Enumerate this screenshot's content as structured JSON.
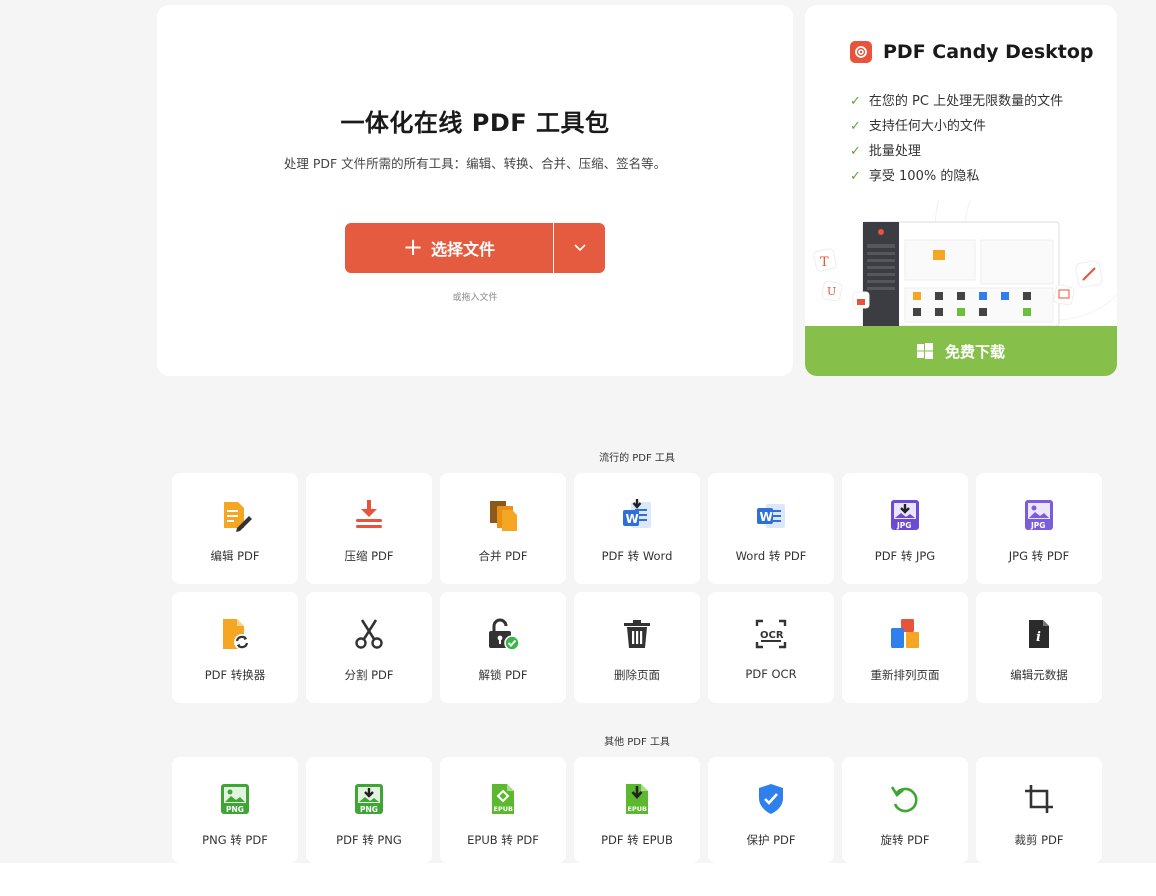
{
  "hero": {
    "title": "一体化在线 PDF 工具包",
    "subtitle": "处理 PDF 文件所需的所有工具：编辑、转换、合并、压缩、签名等。",
    "upload_label": "选择文件",
    "drop_hint": "或拖入文件"
  },
  "promo": {
    "title": "PDF Candy Desktop",
    "features": [
      "在您的 PC 上处理无限数量的文件",
      "支持任何大小的文件",
      "批量处理",
      "享受 100% 的隐私"
    ],
    "download_label": "免费下载"
  },
  "popular": {
    "label": "流行的 PDF 工具",
    "tools": [
      {
        "label": "编辑 PDF",
        "icon": "edit-pdf-icon"
      },
      {
        "label": "压缩 PDF",
        "icon": "compress-pdf-icon"
      },
      {
        "label": "合并 PDF",
        "icon": "merge-pdf-icon"
      },
      {
        "label": "PDF 转 Word",
        "icon": "pdf-to-word-icon"
      },
      {
        "label": "Word 转 PDF",
        "icon": "word-to-pdf-icon"
      },
      {
        "label": "PDF 转 JPG",
        "icon": "pdf-to-jpg-icon"
      },
      {
        "label": "JPG 转 PDF",
        "icon": "jpg-to-pdf-icon"
      },
      {
        "label": "PDF 转换器",
        "icon": "pdf-converter-icon"
      },
      {
        "label": "分割 PDF",
        "icon": "scissors-icon"
      },
      {
        "label": "解锁 PDF",
        "icon": "unlock-icon"
      },
      {
        "label": "删除页面",
        "icon": "trash-icon"
      },
      {
        "label": "PDF OCR",
        "icon": "ocr-icon"
      },
      {
        "label": "重新排列页面",
        "icon": "rearrange-icon"
      },
      {
        "label": "编辑元数据",
        "icon": "metadata-icon"
      }
    ]
  },
  "other": {
    "label": "其他 PDF 工具",
    "tools": [
      {
        "label": "PNG 转 PDF",
        "icon": "png-to-pdf-icon"
      },
      {
        "label": "PDF 转 PNG",
        "icon": "pdf-to-png-icon"
      },
      {
        "label": "EPUB 转 PDF",
        "icon": "epub-to-pdf-icon"
      },
      {
        "label": "PDF 转 EPUB",
        "icon": "pdf-to-epub-icon"
      },
      {
        "label": "保护 PDF",
        "icon": "shield-icon"
      },
      {
        "label": "旋转 PDF",
        "icon": "rotate-icon"
      },
      {
        "label": "裁剪 PDF",
        "icon": "crop-icon"
      }
    ]
  },
  "icon_badges": {
    "jpg": "JPG",
    "png": "PNG",
    "epub": "EPUB",
    "ocr": "OCR",
    "word": "W",
    "info": "i"
  },
  "colors": {
    "accent": "#e55b40",
    "download": "#86c04b",
    "background": "#f5f5f5"
  }
}
